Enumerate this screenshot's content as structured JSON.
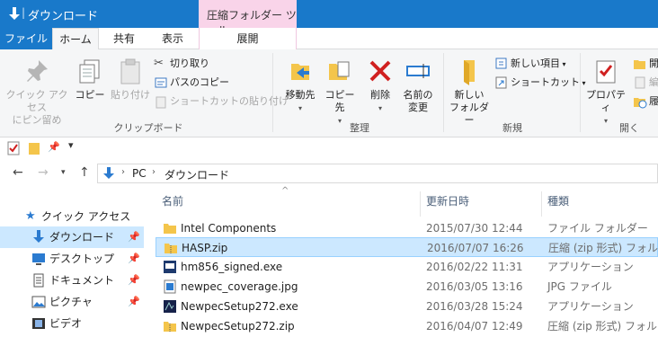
{
  "window": {
    "title": "ダウンロード",
    "context_header": "圧縮フォルダー ツール"
  },
  "tabs": {
    "file": "ファイル",
    "home": "ホーム",
    "share": "共有",
    "view": "表示",
    "manage": "展開"
  },
  "ribbon": {
    "clipboard": {
      "pin_quick_access": "クイック アクセス\nにピン留め",
      "copy": "コピー",
      "paste": "貼り付け",
      "cut": "切り取り",
      "copy_path": "パスのコピー",
      "paste_shortcut": "ショートカットの貼り付け",
      "group_label": "クリップボード"
    },
    "organize": {
      "move_to": "移動先",
      "copy_to": "コピー先",
      "delete": "削除",
      "rename": "名前の\n変更",
      "group_label": "整理"
    },
    "new": {
      "new_folder": "新しい\nフォルダー",
      "new_item": "新しい項目",
      "shortcut": "ショートカット",
      "group_label": "新規"
    },
    "open": {
      "properties": "プロパティ",
      "open_item_1": "開",
      "open_item_2": "編",
      "open_item_3": "履",
      "group_label": "開く"
    }
  },
  "address": {
    "crumb_pc": "PC",
    "crumb_downloads": "ダウンロード"
  },
  "navpane": {
    "quick_access": "クイック アクセス",
    "items": [
      {
        "label": "ダウンロード",
        "icon": "download-icon"
      },
      {
        "label": "デスクトップ",
        "icon": "desktop-icon"
      },
      {
        "label": "ドキュメント",
        "icon": "documents-icon"
      },
      {
        "label": "ピクチャ",
        "icon": "pictures-icon"
      },
      {
        "label": "ビデオ",
        "icon": "videos-icon"
      }
    ]
  },
  "columns": {
    "name": "名前",
    "date": "更新日時",
    "type": "種類"
  },
  "files": [
    {
      "name": "Intel Components",
      "date": "2015/07/30 12:44",
      "type": "ファイル フォルダー",
      "icon": "folder-icon"
    },
    {
      "name": "HASP.zip",
      "date": "2016/07/07 16:26",
      "type": "圧縮 (zip 形式) フォル...",
      "icon": "zip-folder-icon"
    },
    {
      "name": "hm856_signed.exe",
      "date": "2016/02/22 11:31",
      "type": "アプリケーション",
      "icon": "exe-icon"
    },
    {
      "name": "newpec_coverage.jpg",
      "date": "2016/03/05 13:16",
      "type": "JPG ファイル",
      "icon": "image-file-icon"
    },
    {
      "name": "NewpecSetup272.exe",
      "date": "2016/03/28 15:24",
      "type": "アプリケーション",
      "icon": "installer-icon"
    },
    {
      "name": "NewpecSetup272.zip",
      "date": "2016/04/07 12:49",
      "type": "圧縮 (zip 形式) フォル...",
      "icon": "zip-folder-icon"
    }
  ]
}
